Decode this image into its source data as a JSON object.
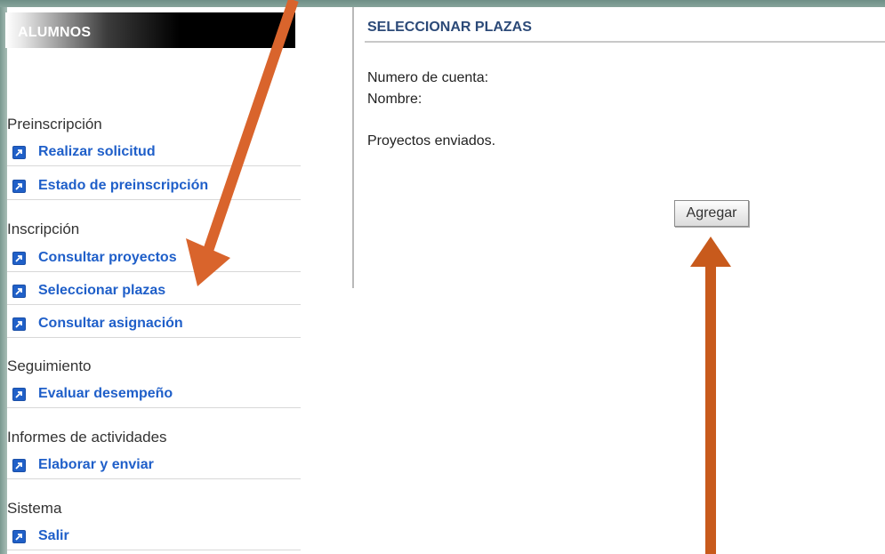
{
  "sidebar": {
    "title": "ALUMNOS",
    "sections": [
      {
        "title": "Preinscripción",
        "items": [
          {
            "label": "Realizar solicitud"
          },
          {
            "label": "Estado de preinscripción"
          }
        ]
      },
      {
        "title": "Inscripción",
        "items": [
          {
            "label": "Consultar proyectos"
          },
          {
            "label": "Seleccionar plazas"
          },
          {
            "label": "Consultar asignación"
          }
        ]
      },
      {
        "title": "Seguimiento",
        "items": [
          {
            "label": "Evaluar desempeño"
          }
        ]
      },
      {
        "title": "Informes de actividades",
        "items": [
          {
            "label": "Elaborar y enviar"
          }
        ]
      },
      {
        "title": "Sistema",
        "items": [
          {
            "label": "Salir"
          }
        ]
      }
    ]
  },
  "main": {
    "title": "SELECCIONAR PLAZAS",
    "account_label": "Numero de cuenta:",
    "name_label": "Nombre:",
    "projects_text": "Proyectos enviados.",
    "add_button": "Agregar"
  },
  "colors": {
    "accent_link": "#1f5fc9",
    "header_title": "#2c4a78",
    "annotation_arrow": "#d9642c"
  },
  "icons": {
    "menu_item": "link-arrow-icon",
    "annotation": "arrow-annotation"
  }
}
